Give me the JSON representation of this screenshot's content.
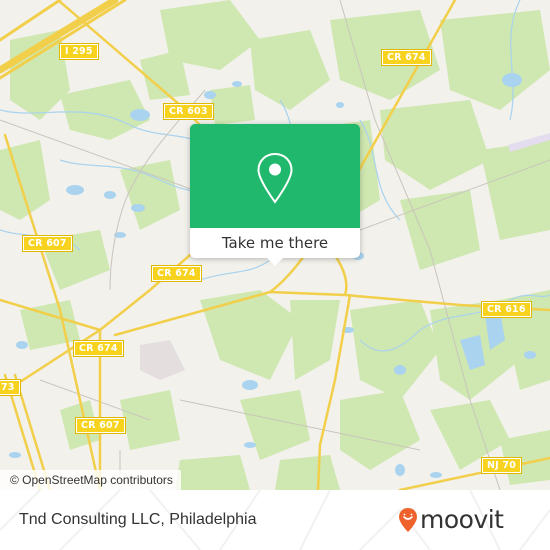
{
  "map": {
    "colors": {
      "background": "#f2f1ec",
      "forest": "#cfe7b0",
      "water": "#a9d3ee",
      "road": "#f7d96a",
      "minor_road": "#c9c5bd",
      "popup_green": "#1fb86c",
      "moovit_orange": "#f0622d"
    },
    "road_labels": [
      {
        "id": "i295",
        "text": "I 295"
      },
      {
        "id": "cr603",
        "text": "CR 603"
      },
      {
        "id": "cr674-top",
        "text": "CR 674"
      },
      {
        "id": "cr607-left",
        "text": "CR 607"
      },
      {
        "id": "cr674-mid",
        "text": "CR 674"
      },
      {
        "id": "cr674-left",
        "text": "CR 674"
      },
      {
        "id": "cr616",
        "text": "CR 616"
      },
      {
        "id": "cr73",
        "text": "73"
      },
      {
        "id": "cr607-bottom",
        "text": "CR 607"
      },
      {
        "id": "nj70",
        "text": "NJ 70"
      }
    ],
    "attribution": "© OpenStreetMap contributors"
  },
  "popup": {
    "icon": "map-pin-icon",
    "button_label": "Take me there"
  },
  "footer": {
    "place_name": "Tnd Consulting LLC, Philadelphia",
    "logo_icon": "moovit-pin-icon",
    "logo_text": "moovit"
  }
}
